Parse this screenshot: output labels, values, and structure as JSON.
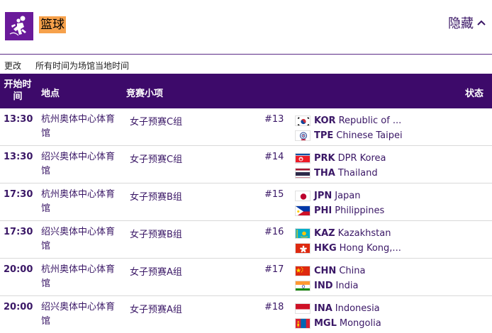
{
  "header": {
    "sport_title": "篮球",
    "sport_icon": "basketball-pictogram-icon",
    "hide_label": "隐藏",
    "hide_icon": "chevron-up-icon"
  },
  "subbar": {
    "update_label": "更改",
    "timezone_note": "所有时间为场馆当地时间"
  },
  "table": {
    "headers": {
      "time": "开始时间",
      "venue": "地点",
      "event": "竞赛小项",
      "status": "状态"
    },
    "rows": [
      {
        "time": "13:30",
        "venue": "杭州奥体中心体育馆",
        "event": "女子预赛C组",
        "match_no": "#13",
        "team1": {
          "code": "KOR",
          "name": "Republic of ...",
          "flag": "flag-kor-icon"
        },
        "team2": {
          "code": "TPE",
          "name": "Chinese Taipei",
          "flag": "flag-tpe-icon"
        }
      },
      {
        "time": "13:30",
        "venue": "绍兴奥体中心体育馆",
        "event": "女子预赛C组",
        "match_no": "#14",
        "team1": {
          "code": "PRK",
          "name": "DPR Korea",
          "flag": "flag-prk-icon"
        },
        "team2": {
          "code": "THA",
          "name": "Thailand",
          "flag": "flag-tha-icon"
        }
      },
      {
        "time": "17:30",
        "venue": "杭州奥体中心体育馆",
        "event": "女子预赛B组",
        "match_no": "#15",
        "team1": {
          "code": "JPN",
          "name": "Japan",
          "flag": "flag-jpn-icon"
        },
        "team2": {
          "code": "PHI",
          "name": "Philippines",
          "flag": "flag-phi-icon"
        }
      },
      {
        "time": "17:30",
        "venue": "绍兴奥体中心体育馆",
        "event": "女子预赛B组",
        "match_no": "#16",
        "team1": {
          "code": "KAZ",
          "name": "Kazakhstan",
          "flag": "flag-kaz-icon"
        },
        "team2": {
          "code": "HKG",
          "name": "Hong Kong,...",
          "flag": "flag-hkg-icon"
        }
      },
      {
        "time": "20:00",
        "venue": "杭州奥体中心体育馆",
        "event": "女子预赛A组",
        "match_no": "#17",
        "team1": {
          "code": "CHN",
          "name": "China",
          "flag": "flag-chn-icon"
        },
        "team2": {
          "code": "IND",
          "name": "India",
          "flag": "flag-ind-icon"
        }
      },
      {
        "time": "20:00",
        "venue": "绍兴奥体中心体育馆",
        "event": "女子预赛A组",
        "match_no": "#18",
        "team1": {
          "code": "INA",
          "name": "Indonesia",
          "flag": "flag-ina-icon"
        },
        "team2": {
          "code": "MGL",
          "name": "Mongolia",
          "flag": "flag-mgl-icon"
        }
      }
    ]
  },
  "colors": {
    "header_bg": "#3d0a6a",
    "text": "#3a1766",
    "title_highlight": "#f6a14b",
    "icon_bg": "#6a1a9a"
  }
}
